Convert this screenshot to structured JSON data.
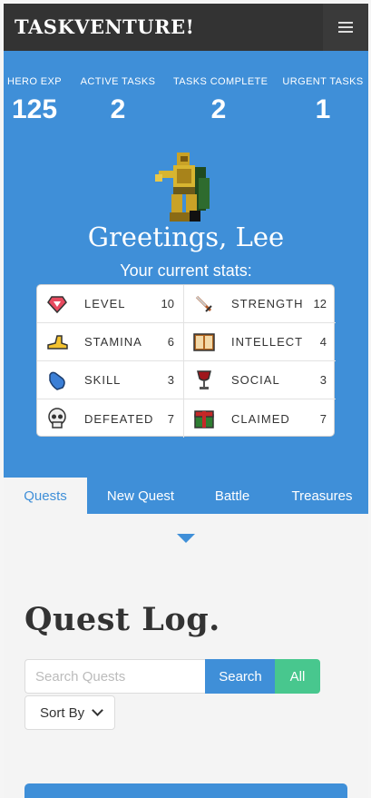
{
  "navbar": {
    "brand": "TASKVENTURE!",
    "menu_icon": "hamburger-icon"
  },
  "summary": [
    {
      "label": "HERO EXP",
      "value": "125"
    },
    {
      "label": "ACTIVE TASKS",
      "value": "2"
    },
    {
      "label": "TASKS COMPLETE",
      "value": "2"
    },
    {
      "label": "URGENT TASKS",
      "value": "1"
    }
  ],
  "hero": {
    "sprite_icon": "knight-sprite-icon",
    "greeting": "Greetings, Lee",
    "subtitle": "Your current stats:"
  },
  "stats": [
    {
      "name": "LEVEL",
      "value": "10",
      "icon": "gem-icon"
    },
    {
      "name": "STRENGTH",
      "value": "12",
      "icon": "sword-icon"
    },
    {
      "name": "STAMINA",
      "value": "6",
      "icon": "boot-icon"
    },
    {
      "name": "INTELLECT",
      "value": "4",
      "icon": "book-icon"
    },
    {
      "name": "SKILL",
      "value": "3",
      "icon": "gauntlet-icon"
    },
    {
      "name": "SOCIAL",
      "value": "3",
      "icon": "goblet-icon"
    },
    {
      "name": "DEFEATED",
      "value": "7",
      "icon": "skull-icon"
    },
    {
      "name": "CLAIMED",
      "value": "7",
      "icon": "treasure-chest-icon"
    }
  ],
  "tabs": [
    {
      "label": "Quests",
      "active": true
    },
    {
      "label": "New Quest",
      "active": false
    },
    {
      "label": "Battle",
      "active": false
    },
    {
      "label": "Treasures",
      "active": false
    }
  ],
  "quest_log": {
    "title": "Quest Log.",
    "search_placeholder": "Search Quests",
    "search_value": "",
    "search_button": "Search",
    "all_button": "All",
    "sort_label": "Sort By"
  },
  "colors": {
    "primary": "#3f8fd8",
    "success": "#48c78e",
    "navbar": "#333333"
  }
}
